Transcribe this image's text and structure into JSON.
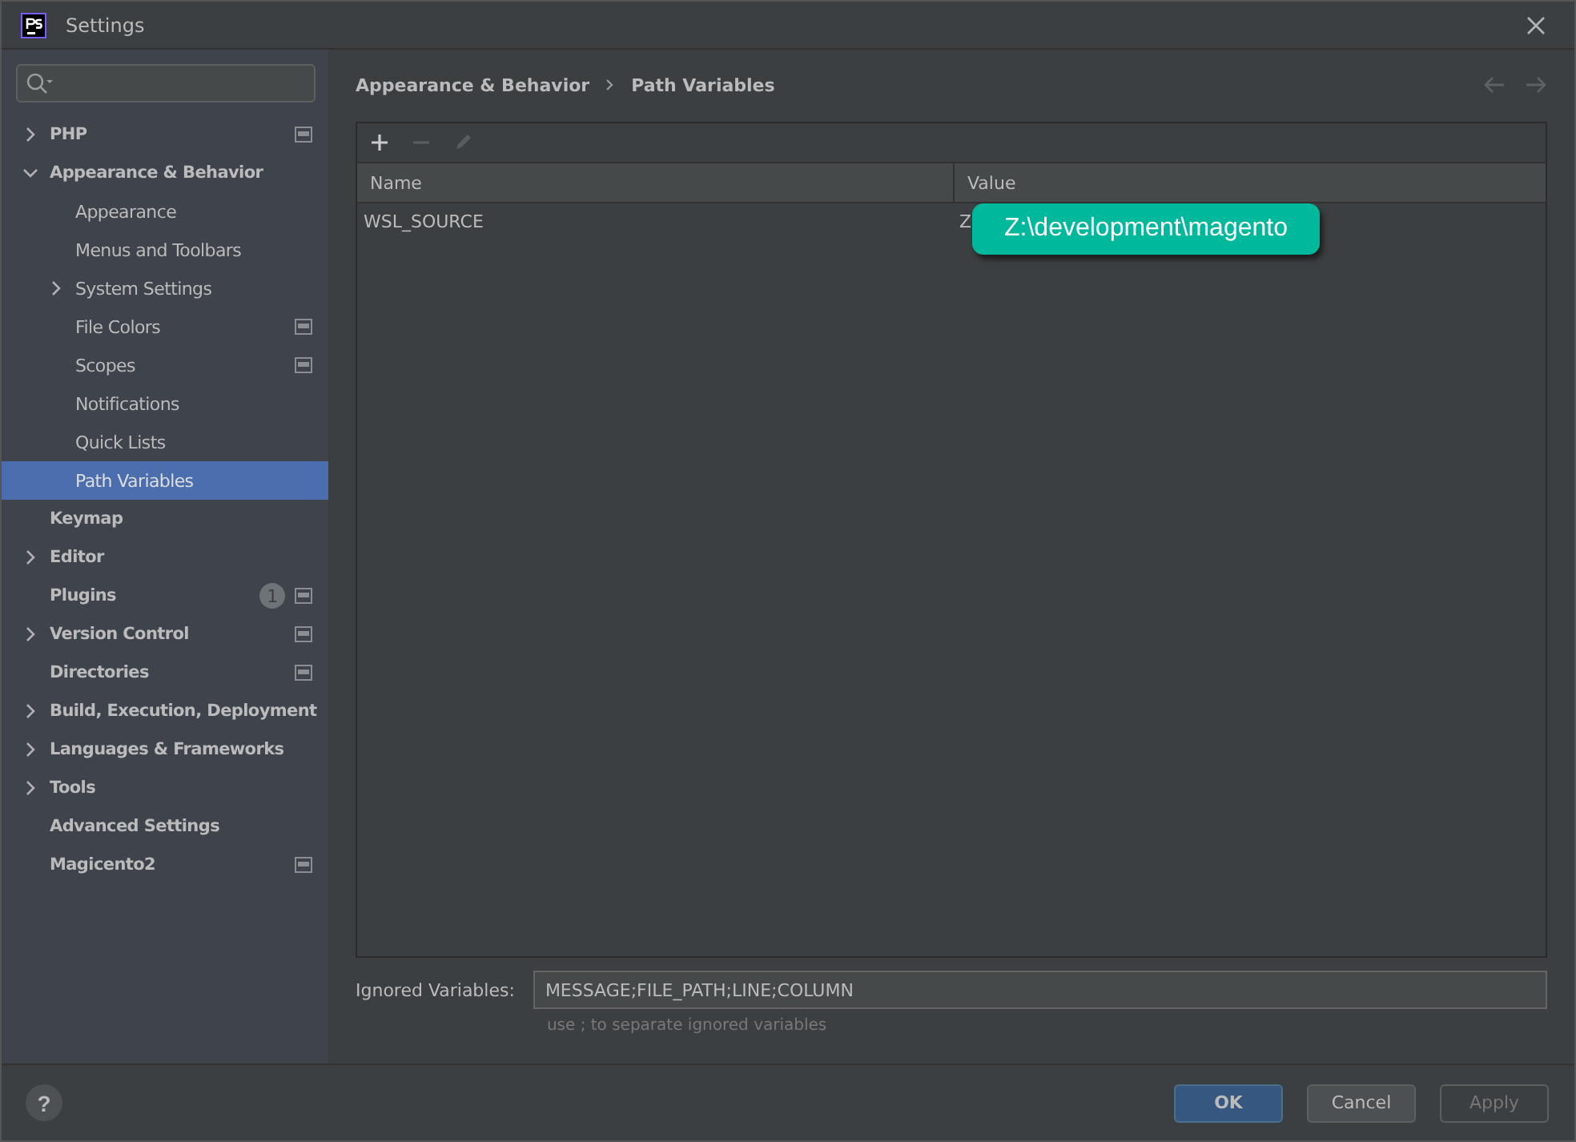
{
  "window": {
    "title": "Settings"
  },
  "sidebar": {
    "items": [
      {
        "label": "PHP",
        "kind": "section",
        "expanded": false,
        "expandable": true,
        "project_level": true
      },
      {
        "label": "Appearance & Behavior",
        "kind": "section",
        "expanded": true,
        "expandable": true,
        "project_level": false,
        "children": [
          {
            "label": "Appearance",
            "kind": "page",
            "selected": false,
            "expandable": false,
            "project_level": false
          },
          {
            "label": "Menus and Toolbars",
            "kind": "page",
            "selected": false,
            "expandable": false,
            "project_level": false
          },
          {
            "label": "System Settings",
            "kind": "page",
            "selected": false,
            "expandable": true,
            "expanded": false,
            "project_level": false
          },
          {
            "label": "File Colors",
            "kind": "page",
            "selected": false,
            "expandable": false,
            "project_level": true
          },
          {
            "label": "Scopes",
            "kind": "page",
            "selected": false,
            "expandable": false,
            "project_level": true
          },
          {
            "label": "Notifications",
            "kind": "page",
            "selected": false,
            "expandable": false,
            "project_level": false
          },
          {
            "label": "Quick Lists",
            "kind": "page",
            "selected": false,
            "expandable": false,
            "project_level": false
          },
          {
            "label": "Path Variables",
            "kind": "page",
            "selected": true,
            "expandable": false,
            "project_level": false
          }
        ]
      },
      {
        "label": "Keymap",
        "kind": "section",
        "expandable": false,
        "project_level": false
      },
      {
        "label": "Editor",
        "kind": "section",
        "expanded": false,
        "expandable": true,
        "project_level": false
      },
      {
        "label": "Plugins",
        "kind": "section",
        "expandable": false,
        "project_level": true,
        "badge": "1"
      },
      {
        "label": "Version Control",
        "kind": "section",
        "expanded": false,
        "expandable": true,
        "project_level": true
      },
      {
        "label": "Directories",
        "kind": "section",
        "expandable": false,
        "project_level": true
      },
      {
        "label": "Build, Execution, Deployment",
        "kind": "section",
        "expanded": false,
        "expandable": true,
        "project_level": false
      },
      {
        "label": "Languages & Frameworks",
        "kind": "section",
        "expanded": false,
        "expandable": true,
        "project_level": false
      },
      {
        "label": "Tools",
        "kind": "section",
        "expanded": false,
        "expandable": true,
        "project_level": false
      },
      {
        "label": "Advanced Settings",
        "kind": "section",
        "expandable": false,
        "project_level": false
      },
      {
        "label": "Magicento2",
        "kind": "section",
        "expandable": false,
        "project_level": true
      }
    ]
  },
  "breadcrumb": [
    "Appearance & Behavior",
    "Path Variables"
  ],
  "table": {
    "toolbar": [
      {
        "kind": "add",
        "disabled": false
      },
      {
        "kind": "remove",
        "disabled": true
      },
      {
        "kind": "edit",
        "disabled": true
      }
    ],
    "columns": [
      "Name",
      "Value"
    ],
    "rows": [
      {
        "name": "WSL_SOURCE",
        "value": "Z"
      }
    ]
  },
  "tooltip": "Z:\\development\\magento",
  "ignored": {
    "label": "Ignored Variables:",
    "value": "MESSAGE;FILE_PATH;LINE;COLUMN",
    "hint": "use ; to separate ignored variables"
  },
  "buttons": [
    {
      "label": "OK",
      "kind": "default",
      "disabled": false
    },
    {
      "label": "Cancel",
      "kind": "normal",
      "disabled": false
    },
    {
      "label": "Apply",
      "kind": "normal",
      "disabled": true
    }
  ],
  "help": "?"
}
